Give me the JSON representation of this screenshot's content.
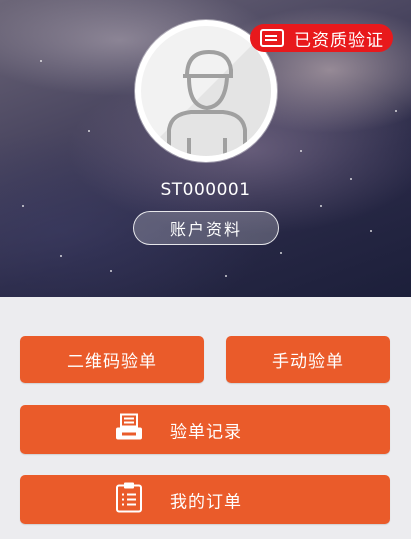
{
  "badge": {
    "label": "已资质验证",
    "color": "#e8191c"
  },
  "profile": {
    "avatar_icon": "user-avatar-icon",
    "account_id": "ST000001",
    "profile_button_label": "账户资料"
  },
  "actions": {
    "qr_label": "二维码验单",
    "manual_label": "手动验单",
    "records_label": "验单记录",
    "records_icon": "printer-icon",
    "orders_label": "我的订单",
    "orders_icon": "order-list-icon",
    "accent_color": "#ea5b2a"
  }
}
